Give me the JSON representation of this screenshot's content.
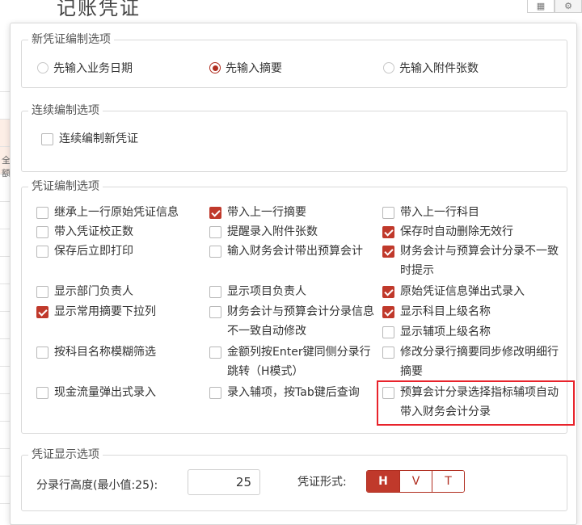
{
  "window": {
    "title": "记账凭证"
  },
  "background": {
    "left_col_fragment": "全额"
  },
  "new_voucher": {
    "legend": "新凭证编制选项",
    "options": [
      {
        "label": "先输入业务日期",
        "selected": false
      },
      {
        "label": "先输入摘要",
        "selected": true
      },
      {
        "label": "先输入附件张数",
        "selected": false
      }
    ]
  },
  "continuous": {
    "legend": "连续编制选项",
    "options": [
      {
        "label": "连续编制新凭证",
        "checked": false
      }
    ]
  },
  "editing": {
    "legend": "凭证编制选项",
    "options": [
      {
        "label": "继承上一行原始凭证信息",
        "checked": false
      },
      {
        "label": "带入上一行摘要",
        "checked": true
      },
      {
        "label": "带入上一行科目",
        "checked": false
      },
      {
        "label": "带入凭证校正数",
        "checked": false
      },
      {
        "label": "提醒录入附件张数",
        "checked": false
      },
      {
        "label": "保存时自动删除无效行",
        "checked": true
      },
      {
        "label": "保存后立即打印",
        "checked": false
      },
      {
        "label": "输入财务会计带出预算会计",
        "checked": false
      },
      {
        "label": "财务会计与预算会计分录不一致时提示",
        "checked": true
      },
      {
        "label": "显示部门负责人",
        "checked": false
      },
      {
        "label": "显示项目负责人",
        "checked": false
      },
      {
        "label": "原始凭证信息弹出式录入",
        "checked": true
      },
      {
        "label": "显示常用摘要下拉列",
        "checked": true
      },
      {
        "label": "财务会计与预算会计分录信息不一致自动修改",
        "checked": false
      },
      {
        "label": "显示科目上级名称",
        "checked": true
      },
      {
        "label": "显示辅项上级名称",
        "checked": false
      },
      {
        "label": "按科目名称模糊筛选",
        "checked": false
      },
      {
        "label": "金额列按Enter键同侧分录行跳转（H模式）",
        "checked": false
      },
      {
        "label": "修改分录行摘要同步修改明细行摘要",
        "checked": false
      },
      {
        "label": "现金流量弹出式录入",
        "checked": false
      },
      {
        "label": "录入辅项，按Tab键后查询",
        "checked": false
      },
      {
        "label": "预算会计分录选择指标辅项自动带入财务会计分录",
        "checked": false
      }
    ]
  },
  "display": {
    "legend": "凭证显示选项",
    "row_height_label": "分录行高度(最小值:25):",
    "row_height_value": "25",
    "form_label": "凭证形式:",
    "forms": [
      {
        "label": "H",
        "selected": true
      },
      {
        "label": "V",
        "selected": false
      },
      {
        "label": "T",
        "selected": false
      }
    ]
  }
}
